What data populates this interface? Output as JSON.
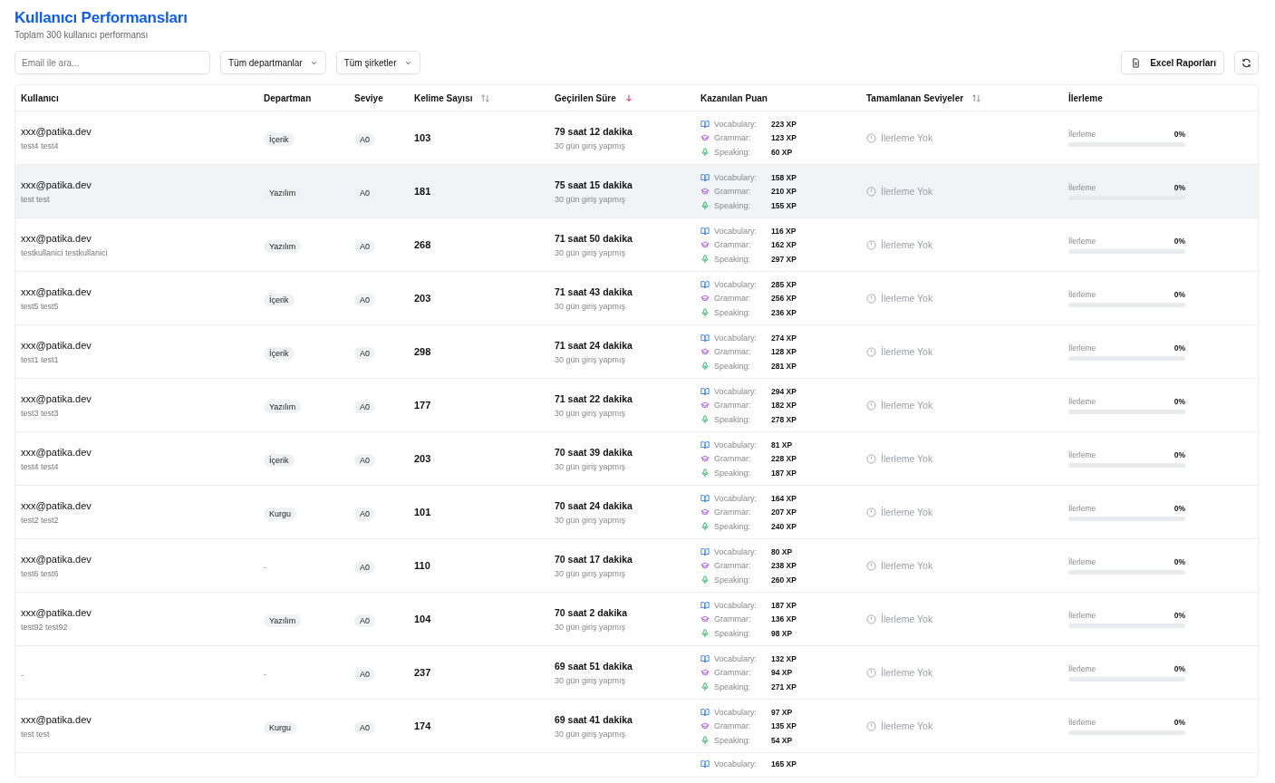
{
  "header": {
    "title": "Kullanıcı Performansları",
    "subtitle": "Toplam 300 kullanıcı performansı"
  },
  "toolbar": {
    "search": {
      "placeholder": "Email ile ara..."
    },
    "filters": [
      "Tüm departmanlar",
      "Tüm şirketler"
    ],
    "export_button": "Excel Raporları"
  },
  "table": {
    "columns": [
      {
        "label": "Kullanıcı",
        "sortable": false
      },
      {
        "label": "Departman",
        "sortable": false
      },
      {
        "label": "Seviye",
        "sortable": false
      },
      {
        "label": "Kelime Sayısı",
        "sortable": true,
        "sorted": false
      },
      {
        "label": "Geçirilen Süre",
        "sortable": true,
        "sorted": true
      },
      {
        "label": "Kazanılan Puan",
        "sortable": false
      },
      {
        "label": "Tamamlanan Seviyeler",
        "sortable": true,
        "sorted": false
      },
      {
        "label": "İlerleme",
        "sortable": false
      }
    ],
    "rows": [
      {
        "highlighted": false,
        "email": "xxx@patika.dev",
        "name": "test4 test4",
        "department": "İçerik",
        "level": "A0",
        "words": "103",
        "time": "79 saat 12 dakika",
        "logins": "30 gün giriş yapmış",
        "points": [
          {
            "kind": "vocabulary",
            "label": "Vocabulary:",
            "value": "223 XP"
          },
          {
            "kind": "grammar",
            "label": "Grammar:",
            "value": "123 XP"
          },
          {
            "kind": "speaking",
            "label": "Speaking:",
            "value": "60 XP"
          }
        ],
        "completed": "İlerleme Yok",
        "progress": {
          "label": "İlerleme",
          "percent": "0%",
          "level": 0
        }
      },
      {
        "highlighted": true,
        "email": "xxx@patika.dev",
        "name": "test test",
        "department": "Yazılım",
        "level": "A0",
        "words": "181",
        "time": "75 saat 15 dakika",
        "logins": "30 gün giriş yapmış",
        "points": [
          {
            "kind": "vocabulary",
            "label": "Vocabulary:",
            "value": "158 XP"
          },
          {
            "kind": "grammar",
            "label": "Grammar:",
            "value": "210 XP"
          },
          {
            "kind": "speaking",
            "label": "Speaking:",
            "value": "155 XP"
          }
        ],
        "completed": "İlerleme Yok",
        "progress": {
          "label": "İlerleme",
          "percent": "0%",
          "level": 0
        }
      },
      {
        "highlighted": false,
        "email": "xxx@patika.dev",
        "name": "testkullanici testkullanici",
        "department": "Yazılım",
        "level": "A0",
        "words": "268",
        "time": "71 saat 50 dakika",
        "logins": "30 gün giriş yapmış",
        "points": [
          {
            "kind": "vocabulary",
            "label": "Vocabulary:",
            "value": "116 XP"
          },
          {
            "kind": "grammar",
            "label": "Grammar:",
            "value": "162 XP"
          },
          {
            "kind": "speaking",
            "label": "Speaking:",
            "value": "297 XP"
          }
        ],
        "completed": "İlerleme Yok",
        "progress": {
          "label": "İlerleme",
          "percent": "0%",
          "level": 0
        }
      },
      {
        "highlighted": false,
        "email": "xxx@patika.dev",
        "name": "test5 test5",
        "department": "İçerik",
        "level": "A0",
        "words": "203",
        "time": "71 saat 43 dakika",
        "logins": "30 gün giriş yapmış",
        "points": [
          {
            "kind": "vocabulary",
            "label": "Vocabulary:",
            "value": "285 XP"
          },
          {
            "kind": "grammar",
            "label": "Grammar:",
            "value": "256 XP"
          },
          {
            "kind": "speaking",
            "label": "Speaking:",
            "value": "236 XP"
          }
        ],
        "completed": "İlerleme Yok",
        "progress": {
          "label": "İlerleme",
          "percent": "0%",
          "level": 0
        }
      },
      {
        "highlighted": false,
        "email": "xxx@patika.dev",
        "name": "test1 test1",
        "department": "İçerik",
        "level": "A0",
        "words": "298",
        "time": "71 saat 24 dakika",
        "logins": "30 gün giriş yapmış",
        "points": [
          {
            "kind": "vocabulary",
            "label": "Vocabulary:",
            "value": "274 XP"
          },
          {
            "kind": "grammar",
            "label": "Grammar:",
            "value": "128 XP"
          },
          {
            "kind": "speaking",
            "label": "Speaking:",
            "value": "281 XP"
          }
        ],
        "completed": "İlerleme Yok",
        "progress": {
          "label": "İlerleme",
          "percent": "0%",
          "level": 0
        }
      },
      {
        "highlighted": false,
        "email": "xxx@patika.dev",
        "name": "test3 test3",
        "department": "Yazılım",
        "level": "A0",
        "words": "177",
        "time": "71 saat 22 dakika",
        "logins": "30 gün giriş yapmış",
        "points": [
          {
            "kind": "vocabulary",
            "label": "Vocabulary:",
            "value": "294 XP"
          },
          {
            "kind": "grammar",
            "label": "Grammar:",
            "value": "182 XP"
          },
          {
            "kind": "speaking",
            "label": "Speaking:",
            "value": "278 XP"
          }
        ],
        "completed": "İlerleme Yok",
        "progress": {
          "label": "İlerleme",
          "percent": "0%",
          "level": 0
        }
      },
      {
        "highlighted": false,
        "email": "xxx@patika.dev",
        "name": "test4 test4",
        "department": "İçerik",
        "level": "A0",
        "words": "203",
        "time": "70 saat 39 dakika",
        "logins": "30 gün giriş yapmış",
        "points": [
          {
            "kind": "vocabulary",
            "label": "Vocabulary:",
            "value": "81 XP"
          },
          {
            "kind": "grammar",
            "label": "Grammar:",
            "value": "228 XP"
          },
          {
            "kind": "speaking",
            "label": "Speaking:",
            "value": "187 XP"
          }
        ],
        "completed": "İlerleme Yok",
        "progress": {
          "label": "İlerleme",
          "percent": "0%",
          "level": 0
        }
      },
      {
        "highlighted": false,
        "email": "xxx@patika.dev",
        "name": "test2 test2",
        "department": "Kurgu",
        "level": "A0",
        "words": "101",
        "time": "70 saat 24 dakika",
        "logins": "30 gün giriş yapmış",
        "points": [
          {
            "kind": "vocabulary",
            "label": "Vocabulary:",
            "value": "164 XP"
          },
          {
            "kind": "grammar",
            "label": "Grammar:",
            "value": "207 XP"
          },
          {
            "kind": "speaking",
            "label": "Speaking:",
            "value": "240 XP"
          }
        ],
        "completed": "İlerleme Yok",
        "progress": {
          "label": "İlerleme",
          "percent": "0%",
          "level": 0
        }
      },
      {
        "highlighted": false,
        "email": "xxx@patika.dev",
        "name": "test6 test6",
        "department": "-",
        "level": "A0",
        "words": "110",
        "time": "70 saat 17 dakika",
        "logins": "30 gün giriş yapmış",
        "points": [
          {
            "kind": "vocabulary",
            "label": "Vocabulary:",
            "value": "80 XP"
          },
          {
            "kind": "grammar",
            "label": "Grammar:",
            "value": "238 XP"
          },
          {
            "kind": "speaking",
            "label": "Speaking:",
            "value": "260 XP"
          }
        ],
        "completed": "İlerleme Yok",
        "progress": {
          "label": "İlerleme",
          "percent": "0%",
          "level": 0
        }
      },
      {
        "highlighted": false,
        "email": "xxx@patika.dev",
        "name": "test92 test92",
        "department": "Yazılım",
        "level": "A0",
        "words": "104",
        "time": "70 saat 2 dakika",
        "logins": "30 gün giriş yapmış",
        "points": [
          {
            "kind": "vocabulary",
            "label": "Vocabulary:",
            "value": "187 XP"
          },
          {
            "kind": "grammar",
            "label": "Grammar:",
            "value": "136 XP"
          },
          {
            "kind": "speaking",
            "label": "Speaking:",
            "value": "98 XP"
          }
        ],
        "completed": "İlerleme Yok",
        "progress": {
          "label": "İlerleme",
          "percent": "0%",
          "level": 0
        }
      },
      {
        "highlighted": false,
        "name": "-",
        "department": "-",
        "level": "A0",
        "words": "237",
        "time": "69 saat 51 dakika",
        "logins": "30 gün giriş yapmış",
        "points": [
          {
            "kind": "vocabulary",
            "label": "Vocabulary:",
            "value": "132 XP"
          },
          {
            "kind": "grammar",
            "label": "Grammar:",
            "value": "94 XP"
          },
          {
            "kind": "speaking",
            "label": "Speaking:",
            "value": "271 XP"
          }
        ],
        "completed": "İlerleme Yok",
        "progress": {
          "label": "İlerleme",
          "percent": "0%",
          "level": 0
        }
      },
      {
        "highlighted": false,
        "email": "xxx@patika.dev",
        "name": "test test",
        "department": "Kurgu",
        "level": "A0",
        "words": "174",
        "time": "69 saat 41 dakika",
        "logins": "30 gün giriş yapmış",
        "points": [
          {
            "kind": "vocabulary",
            "label": "Vocabulary:",
            "value": "97 XP"
          },
          {
            "kind": "grammar",
            "label": "Grammar:",
            "value": "135 XP"
          },
          {
            "kind": "speaking",
            "label": "Speaking:",
            "value": "54 XP"
          }
        ],
        "completed": "İlerleme Yok",
        "progress": {
          "label": "İlerleme",
          "percent": "0%",
          "level": 0
        }
      },
      {
        "points": [
          {
            "kind": "vocabulary",
            "label": "Vocabulary:",
            "value": "165 XP"
          }
        ]
      }
    ]
  }
}
